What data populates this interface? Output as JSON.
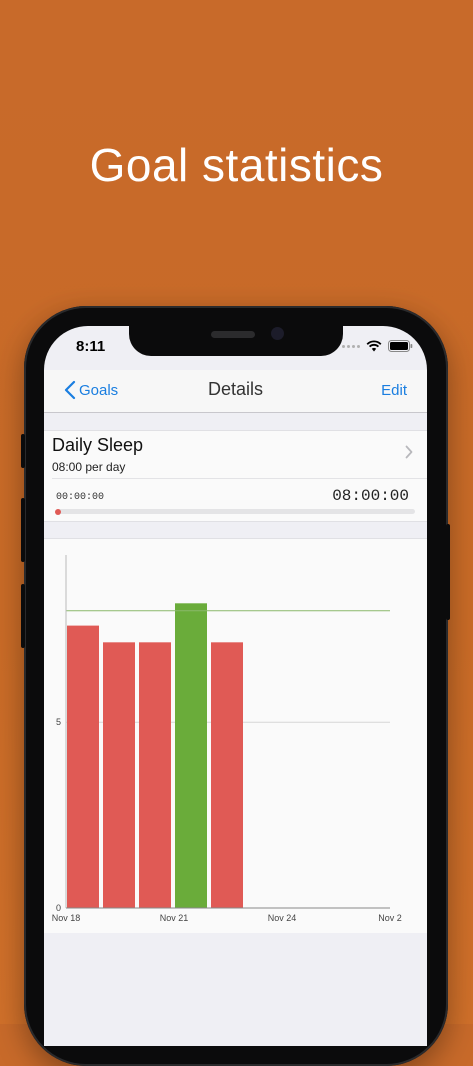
{
  "headline": "Goal statistics",
  "status_bar": {
    "time": "8:11"
  },
  "nav": {
    "back_label": "Goals",
    "title": "Details",
    "edit_label": "Edit"
  },
  "goal": {
    "name": "Daily Sleep",
    "target": "08:00 per day",
    "progress_start": "00:00:00",
    "progress_end": "08:00:00",
    "progress_fraction": 0.0
  },
  "colors": {
    "background": "#c96b27",
    "accent_blue": "#1a7ee0",
    "bar_under_goal": "#e05a55",
    "bar_goal_met": "#6aac3a",
    "goal_line": "#8ab86a"
  },
  "chart_data": {
    "type": "bar",
    "x_ticks": [
      "Nov 18",
      "Nov 21",
      "Nov 24",
      "Nov 2"
    ],
    "y_ticks": [
      "0",
      "5"
    ],
    "ylim": [
      0,
      9.5
    ],
    "goal_value": 8,
    "bars": [
      {
        "day": 0,
        "value": 7.6,
        "met": false
      },
      {
        "day": 1,
        "value": 7.15,
        "met": false
      },
      {
        "day": 2,
        "value": 7.15,
        "met": false
      },
      {
        "day": 3,
        "value": 8.2,
        "met": true
      },
      {
        "day": 4,
        "value": 7.15,
        "met": false
      }
    ],
    "x_range_days": 9,
    "grid": true
  }
}
